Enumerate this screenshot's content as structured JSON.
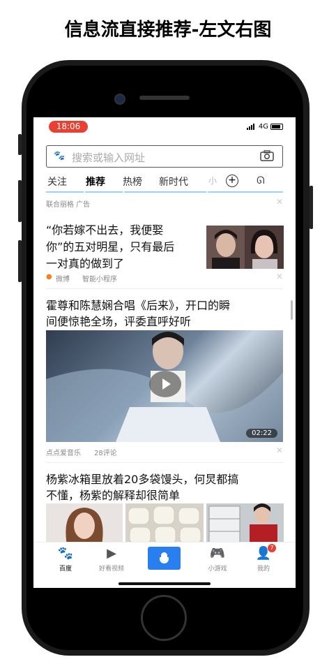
{
  "page_title": "信息流直接推荐-左文右图",
  "status": {
    "time": "18:06",
    "network": "4G"
  },
  "search": {
    "placeholder": "搜索或输入网址"
  },
  "tabs": [
    "关注",
    "推荐",
    "热榜",
    "新时代",
    "小"
  ],
  "feed": {
    "ad_meta": "联合丽格  广告",
    "item1": {
      "line1": "“你若嫁不出去，我便娶",
      "line2": "你”的五对明星，只有最后",
      "line3": "一对真的做到了",
      "source": "微博",
      "tag": "智能小程序"
    },
    "item2": {
      "line1": "霍尊和陈慧娴合唱《后来》，开口的瞬",
      "line2": "间便惊艳全场，评委直呼好听",
      "duration": "02:22",
      "source": "点点爱音乐",
      "comments": "28评论"
    },
    "item3": {
      "line1": "杨紫冰箱里放着20多袋馒头，何炅都搞",
      "line2": "不懂，杨紫的解释却很简单"
    }
  },
  "nav": {
    "home": "百度",
    "video": "好看视频",
    "game": "小游戏",
    "mine": "我的",
    "badge": "7"
  },
  "colors": {
    "accent": "#2a7ff0",
    "time_pill": "#e84133"
  }
}
